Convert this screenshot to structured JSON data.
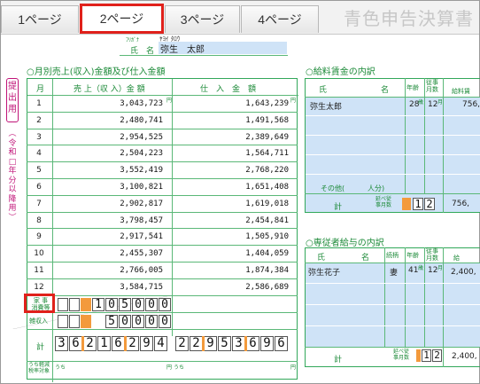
{
  "tabs": [
    "1ページ",
    "2ページ",
    "3ページ",
    "4ページ"
  ],
  "app_title": "青色申告決算書",
  "header": {
    "furigana_small": "ﾌﾘｶﾞﾅ",
    "furigana_name": "ﾔﾖｲ ﾀﾛｳ",
    "name_label": "氏　名",
    "name_value": "弥生　太郎"
  },
  "side": {
    "submit": "提出用",
    "era": "（令和□年分以降用）"
  },
  "sales": {
    "title": "○月別売上(収入)金額及び仕入金額",
    "col_month": "月",
    "col_sales": "売 上（収 入）金 額",
    "col_purchase": "仕　入　金　額",
    "yen": "円",
    "rows": [
      {
        "month": "1",
        "sales": "3,043,723",
        "purchase": "1,643,239"
      },
      {
        "month": "2",
        "sales": "2,480,741",
        "purchase": "1,491,568"
      },
      {
        "month": "3",
        "sales": "2,954,525",
        "purchase": "2,389,649"
      },
      {
        "month": "4",
        "sales": "2,504,223",
        "purchase": "1,564,711"
      },
      {
        "month": "5",
        "sales": "3,552,419",
        "purchase": "2,768,220"
      },
      {
        "month": "6",
        "sales": "3,100,821",
        "purchase": "1,651,408"
      },
      {
        "month": "7",
        "sales": "2,902,817",
        "purchase": "1,619,018"
      },
      {
        "month": "8",
        "sales": "3,798,457",
        "purchase": "2,454,841"
      },
      {
        "month": "9",
        "sales": "2,917,541",
        "purchase": "1,505,910"
      },
      {
        "month": "10",
        "sales": "2,455,307",
        "purchase": "1,404,059"
      },
      {
        "month": "11",
        "sales": "2,766,005",
        "purchase": "1,874,384"
      },
      {
        "month": "12",
        "sales": "3,584,715",
        "purchase": "2,586,689"
      }
    ],
    "kaji_label": "家 事\n消費等",
    "kaji_digits": [
      "1",
      "0",
      "5",
      "0",
      "0",
      "0"
    ],
    "zatsu_label": "雑収入",
    "zatsu_digits": [
      "5",
      "0",
      "0",
      "0",
      "0"
    ],
    "total_label": "計",
    "total_sales_digits": [
      "3",
      "6",
      "2",
      "1",
      "6",
      "2",
      "9",
      "4"
    ],
    "total_purchase_digits": [
      "2",
      "2",
      "9",
      "5",
      "3",
      "6",
      "9",
      "6"
    ],
    "bottom_label": "うち軽減\n税率対象",
    "uchi": "うち",
    "uchi_yen": "円"
  },
  "salary": {
    "title": "○給料賃金の内訳",
    "col_name": "氏",
    "col_name2": "名",
    "col_age": "年齢",
    "col_months": "従事\n月数",
    "col_amount": "給料賃",
    "row1": {
      "name": "弥生太郎",
      "age": "28",
      "age_unit": "歳",
      "months": "12",
      "months_unit": "月",
      "amount": "756,"
    },
    "other": "その他(",
    "other_people": "人分)",
    "total_label": "計",
    "nobe_label": "延べ従\n事月数",
    "total_digits": [
      "1",
      "2"
    ],
    "total_amount": "756,"
  },
  "family": {
    "title": "○専従者給与の内訳",
    "col_name": "氏",
    "col_name2": "名",
    "col_rel": "続柄",
    "col_age": "年齢",
    "col_months": "従事\n月数",
    "col_amount": "給",
    "row1": {
      "name": "弥生花子",
      "rel": "妻",
      "age": "41",
      "age_unit": "歳",
      "months": "12",
      "months_unit": "月",
      "amount": "2,400,"
    },
    "total_label": "計",
    "nobe_label": "延べ従\n事月数",
    "total_digits": [
      "1",
      "2"
    ],
    "total_amount": "2,400,"
  }
}
